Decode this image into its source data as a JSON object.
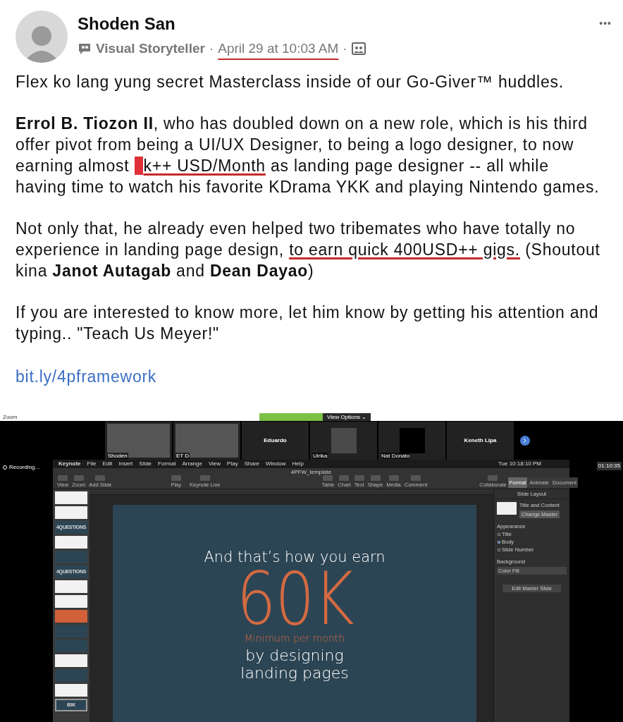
{
  "post": {
    "author": "Shoden San",
    "group": "Visual Storyteller",
    "separator": "·",
    "timestamp": "April 29 at 10:03 AM",
    "timestamp_underlined": true,
    "more": "•••",
    "paragraphs": [
      [
        {
          "text": "Flex ko lang yung secret Masterclass inside of our Go-Giver™ huddles.",
          "underlined": false
        }
      ],
      [
        {
          "text": "**Errol B. Tiozon II**, who has doubled down on a new role, which is his third offer pivot from being a UI/UX Designer, to being a logo designer, to now earning almost ",
          "underlined": false
        },
        {
          "text": "k++ USD/Month",
          "underlined": true,
          "scribbled": true
        },
        {
          "text": " as landing page designer -- all while having time to watch his favorite KDrama YKK and playing Nintendo games.",
          "underlined": false
        }
      ],
      [
        {
          "text": "Not only that, he already even helped two tribemates who have totally no experience in landing page design, ",
          "underlined": false
        },
        {
          "text": "to earn quick 400USD++ gigs.",
          "underlined": true
        },
        {
          "text": " (Shoutout kina **Janot Autagab** and **Dean Dayao**)",
          "underlined": false
        }
      ],
      [
        {
          "text": "If you are interested to know more, let him know by getting his attention and typing.. \"Teach Us Meyer!\"",
          "underlined": false
        }
      ]
    ],
    "link": "bit.ly/4pframework"
  },
  "zoom": {
    "title": "Zoom",
    "view_options": "View Options ⌄",
    "participants": [
      {
        "name": "Shoden",
        "kind": "video"
      },
      {
        "name": "ET D",
        "kind": "video"
      },
      {
        "name": "Eduardo",
        "kind": "name"
      },
      {
        "name": "Ulrika",
        "kind": "photo"
      },
      {
        "name": "Nat Donato",
        "kind": "blank"
      },
      {
        "name": "Keneth Lipa",
        "kind": "name"
      }
    ],
    "recording": "Recording...",
    "timer": "01:10:35",
    "keynote": {
      "menu": [
        "Keynote",
        "File",
        "Edit",
        "Insert",
        "Slide",
        "Format",
        "Arrange",
        "View",
        "Play",
        "Share",
        "Window",
        "Help"
      ],
      "clock": "Tue 10:18:10 PM",
      "doc_title": "4PFW_template",
      "toolbar_left": [
        "View",
        "Zoom",
        "Add Slide"
      ],
      "toolbar_play": [
        "Play",
        "Keynote Live"
      ],
      "toolbar_center": [
        "Table",
        "Chart",
        "Text",
        "Shape",
        "Media",
        "Comment"
      ],
      "collaborate": "Collaborate",
      "inspector_tabs": [
        {
          "label": "Format",
          "selected": true
        },
        {
          "label": "Animate",
          "selected": false
        },
        {
          "label": "Document",
          "selected": false
        }
      ],
      "inspector": {
        "heading": "Slide Layout",
        "layout": "Title and Content",
        "change_master": "Change Master",
        "appearance": "Appearance",
        "options": [
          {
            "label": "Title",
            "checked": false
          },
          {
            "label": "Body",
            "checked": true
          },
          {
            "label": "Slide Number",
            "checked": false
          }
        ],
        "background": "Background",
        "fill": "Color Fill",
        "edit_master": "Edit Master Slide"
      },
      "thumbnails": [
        {
          "kind": "light",
          "selected": false
        },
        {
          "kind": "light",
          "selected": false
        },
        {
          "kind": "dark",
          "text": "4QUESTIONS",
          "selected": false
        },
        {
          "kind": "light",
          "selected": false
        },
        {
          "kind": "dark",
          "selected": false
        },
        {
          "kind": "dark",
          "text": "4QUESTIONS",
          "selected": false
        },
        {
          "kind": "light",
          "selected": false
        },
        {
          "kind": "light",
          "selected": false
        },
        {
          "kind": "orange",
          "selected": false
        },
        {
          "kind": "dark",
          "selected": false
        },
        {
          "kind": "dark",
          "selected": false
        },
        {
          "kind": "light",
          "selected": false
        },
        {
          "kind": "dark",
          "selected": false
        },
        {
          "kind": "light",
          "selected": false
        },
        {
          "kind": "dark",
          "text": "60K",
          "selected": true
        }
      ],
      "slide": [
        {
          "kind": "heading",
          "text": "And that’s how you earn"
        },
        {
          "kind": "big",
          "text": "60K"
        },
        {
          "kind": "sub",
          "text": "Minimum per month"
        },
        {
          "kind": "body",
          "text": "by designing"
        },
        {
          "kind": "body",
          "text": "landing pages"
        }
      ]
    }
  }
}
